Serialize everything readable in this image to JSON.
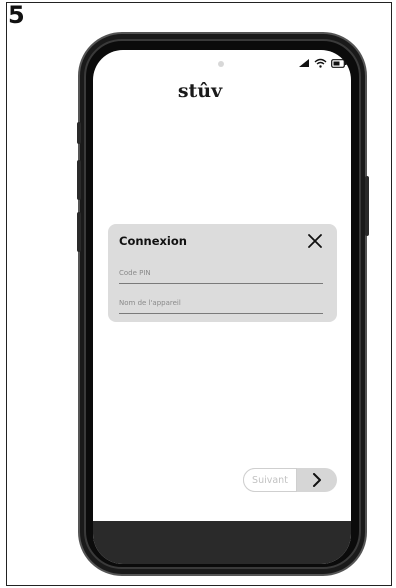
{
  "step": {
    "number": "5"
  },
  "app": {
    "logo_text": "stûv"
  },
  "status_bar": {
    "icons": [
      "signal-icon",
      "wifi-icon",
      "battery-icon"
    ]
  },
  "dialog": {
    "title": "Connexion",
    "close_icon": "close-icon",
    "fields": {
      "pin_placeholder": "Code PIN",
      "pin_value": "",
      "name_placeholder": "Nom de l'appareil",
      "name_value": ""
    }
  },
  "footer": {
    "next_label": "Suivant",
    "next_icon": "chevron-right-icon"
  },
  "colors": {
    "dialog_bg": "#dcdcdc",
    "phone_frame": "#1a1a1a",
    "bottom_bar": "#2a2a2a",
    "disabled_text": "#c2c2c2"
  }
}
